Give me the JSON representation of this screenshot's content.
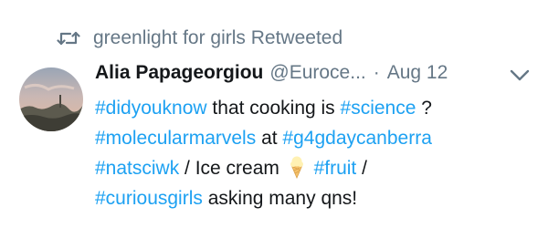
{
  "retweet": {
    "icon": "retweet-icon",
    "text": "greenlight for girls Retweeted"
  },
  "tweet": {
    "author_name": "Alia Papageorgiou",
    "author_handle": "@Euroce...",
    "separator": "·",
    "date": "Aug 12",
    "menu_icon": "chevron-down-icon",
    "lines": [
      [
        {
          "text": "#didyouknow",
          "type": "hashtag"
        },
        {
          "text": " that cooking is ",
          "type": "text"
        },
        {
          "text": "#science",
          "type": "hashtag"
        },
        {
          "text": " ?",
          "type": "text"
        }
      ],
      [
        {
          "text": "#molecularmarvels",
          "type": "hashtag"
        },
        {
          "text": " at ",
          "type": "text"
        },
        {
          "text": "#g4gdaycanberra",
          "type": "hashtag"
        }
      ],
      [
        {
          "text": "#natsciwk",
          "type": "hashtag"
        },
        {
          "text": " / Ice cream ",
          "type": "text"
        },
        {
          "text": "ice-cream-emoji",
          "type": "emoji"
        },
        {
          "text": " ",
          "type": "text"
        },
        {
          "text": "#fruit",
          "type": "hashtag"
        },
        {
          "text": " /",
          "type": "text"
        }
      ],
      [
        {
          "text": "#curiousgirls",
          "type": "hashtag"
        },
        {
          "text": " asking many qns!",
          "type": "text"
        }
      ]
    ]
  },
  "colors": {
    "text": "#14171a",
    "muted": "#657786",
    "link": "#1da1f2",
    "background": "#ffffff"
  }
}
